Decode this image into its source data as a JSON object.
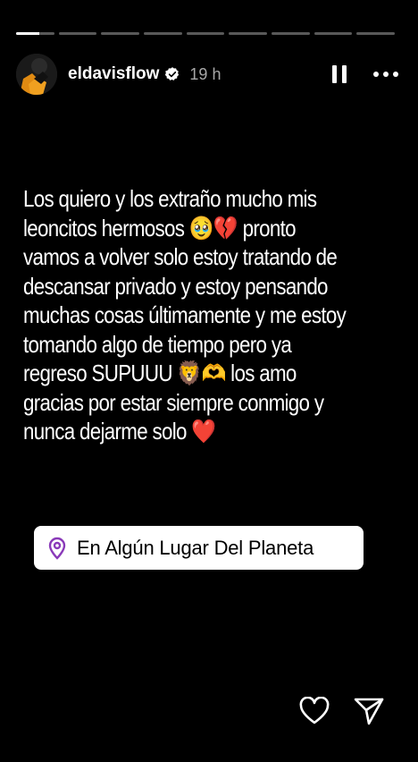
{
  "story": {
    "progress": {
      "segments": 9,
      "active_index": 0,
      "active_fraction": 0.6
    },
    "user": {
      "username": "eldavisflow",
      "verified": true,
      "time": "19 h"
    },
    "text_lines": [
      "Los quiero y los extraño mucho mis",
      "leoncitos hermosos 🥹💔 pronto",
      "vamos a volver solo estoy tratando de",
      "descansar privado y estoy pensando",
      "muchas cosas últimamente y me estoy",
      "tomando algo de tiempo pero ya",
      "regreso SUPUUU 🦁🫶 los amo",
      "gracias por estar siempre conmigo y",
      "nunca dejarme solo ❤️"
    ],
    "location_sticker": {
      "label": "En Algún Lugar Del Planeta",
      "icon_color": "#8a3ab9"
    }
  },
  "colors": {
    "background": "#000000",
    "text": "#ffffff",
    "verified_badge": "#ffffff"
  }
}
